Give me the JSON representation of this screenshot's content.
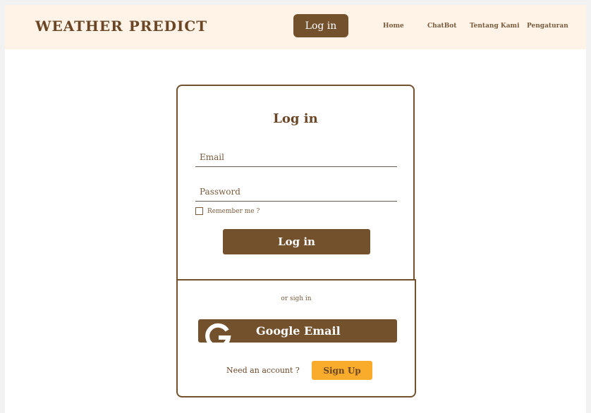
{
  "header": {
    "brand": "WEATHER PREDICT",
    "login_label": "Log in",
    "nav": [
      {
        "label": "Home"
      },
      {
        "label": "ChatBot"
      },
      {
        "label": "Tentang Kami"
      },
      {
        "label": "Pengaturan"
      }
    ]
  },
  "login_form": {
    "title": "Log in",
    "email_placeholder": "Email",
    "email_value": "",
    "password_placeholder": "Password",
    "password_value": "",
    "remember_label": "Remember me ?",
    "remember_checked": false,
    "submit_label": "Log in"
  },
  "alt_signin": {
    "divider_text": "or sigh in",
    "google_label": "Google Email",
    "need_account_text": "Need an account ?",
    "signup_label": "Sign Up"
  },
  "colors": {
    "brown": "#74512d",
    "header_bg": "#fef3e6",
    "signup_yellow": "#f9ab2c"
  }
}
